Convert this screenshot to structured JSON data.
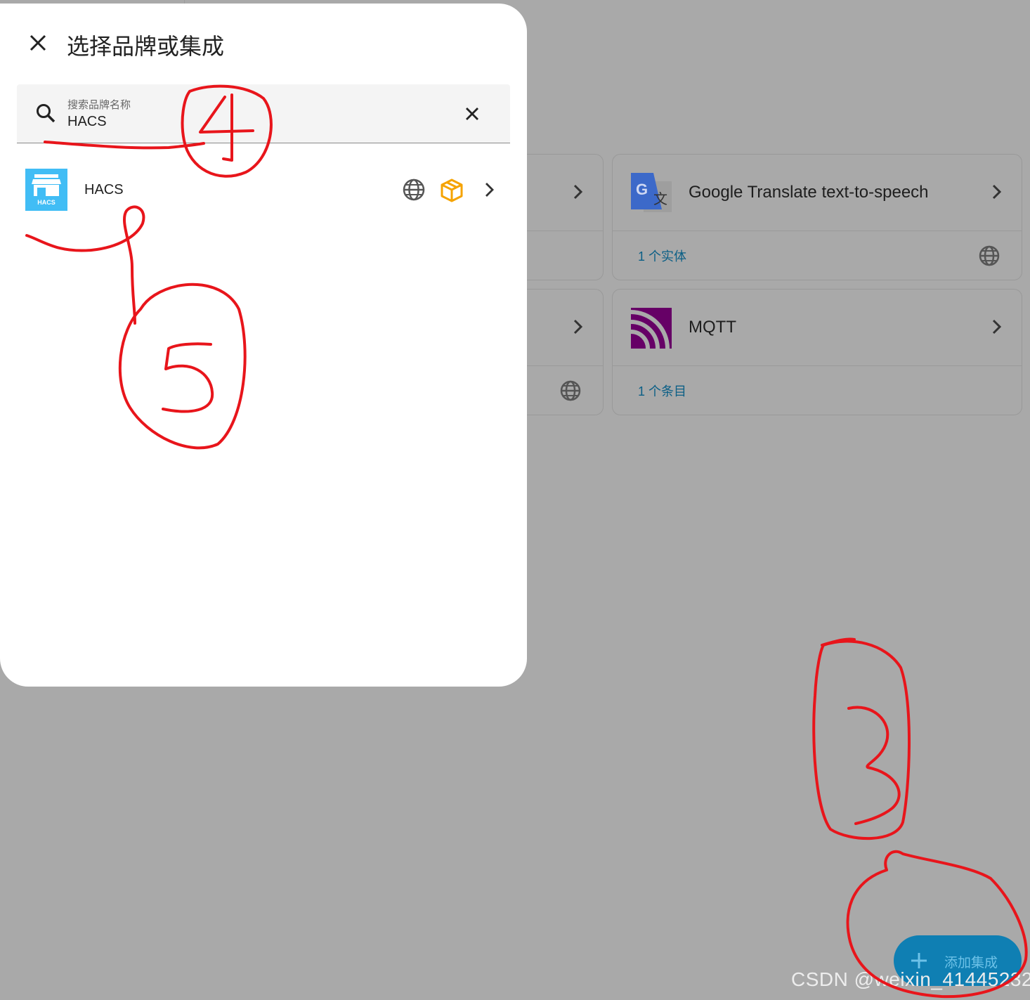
{
  "dialog": {
    "title": "选择品牌或集成",
    "search": {
      "label": "搜索品牌名称",
      "value": "HACS"
    },
    "results": [
      {
        "name": "HACS",
        "logo_text": "HACS"
      }
    ]
  },
  "background": {
    "cards": [
      {
        "title": "Google Translate text-to-speech",
        "footer": "1 个实体"
      },
      {
        "title": "MQTT",
        "footer": "1 个条目"
      }
    ]
  },
  "fab": {
    "label": "添加集成"
  },
  "watermark": "CSDN @weixin_41445232",
  "annotations": [
    "4",
    "5",
    "3"
  ],
  "colors": {
    "accent": "#41bdf5",
    "fab": "#0f7fb3",
    "annotation": "#e8151b",
    "mqtt": "#660066",
    "link": "#0b5f86"
  }
}
